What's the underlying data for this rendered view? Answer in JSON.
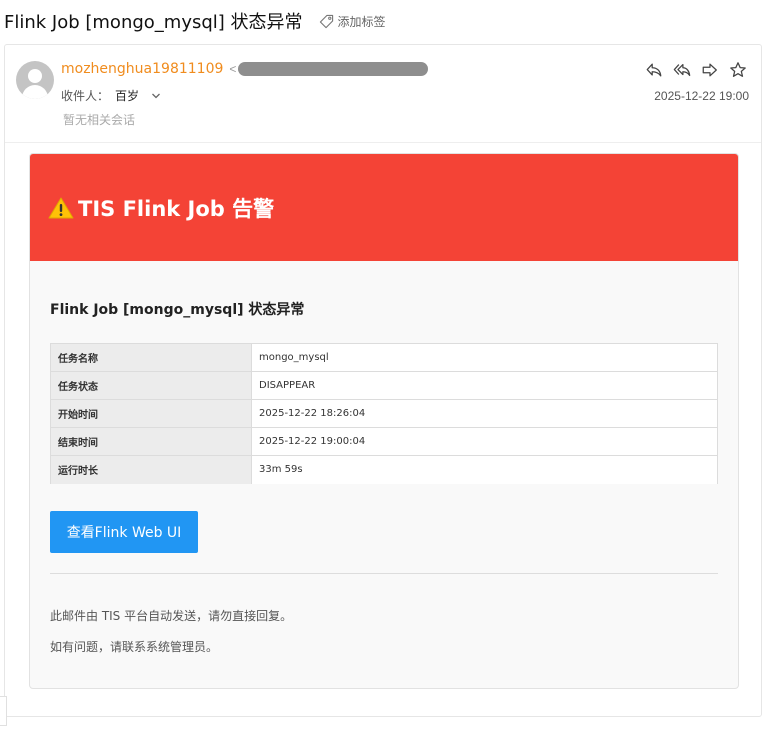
{
  "subject": {
    "title": "Flink Job [mongo_mysql] 状态异常",
    "add_tag_label": "添加标签"
  },
  "header": {
    "sender_name": "mozhenghua19811109",
    "sender_email_open": "<",
    "recipient_label": "收件人：",
    "recipient_name": "百岁",
    "no_thread_text": "暂无相关会话",
    "datetime": "2025-12-22 19:00",
    "actions": {
      "reply_icon": "reply-icon",
      "reply_all_icon": "reply-all-icon",
      "forward_icon": "forward-icon",
      "star_icon": "star-icon"
    }
  },
  "alert": {
    "title": "TIS Flink Job 告警",
    "heading": "Flink Job [mongo_mysql] 状态异常",
    "rows": [
      {
        "key": "任务名称",
        "value": "mongo_mysql"
      },
      {
        "key": "任务状态",
        "value": "DISAPPEAR"
      },
      {
        "key": "开始时间",
        "value": "2025-12-22 18:26:04"
      },
      {
        "key": "结束时间",
        "value": "2025-12-22 19:00:04"
      },
      {
        "key": "运行时长",
        "value": "33m 59s"
      }
    ],
    "button_label": "查看Flink Web UI",
    "footer_line1": "此邮件由 TIS 平台自动发送，请勿直接回复。",
    "footer_line2": "如有问题，请联系系统管理员。"
  },
  "colors": {
    "alert_red": "#f44336",
    "button_blue": "#2196f3",
    "sender_orange": "#f08c1e"
  }
}
